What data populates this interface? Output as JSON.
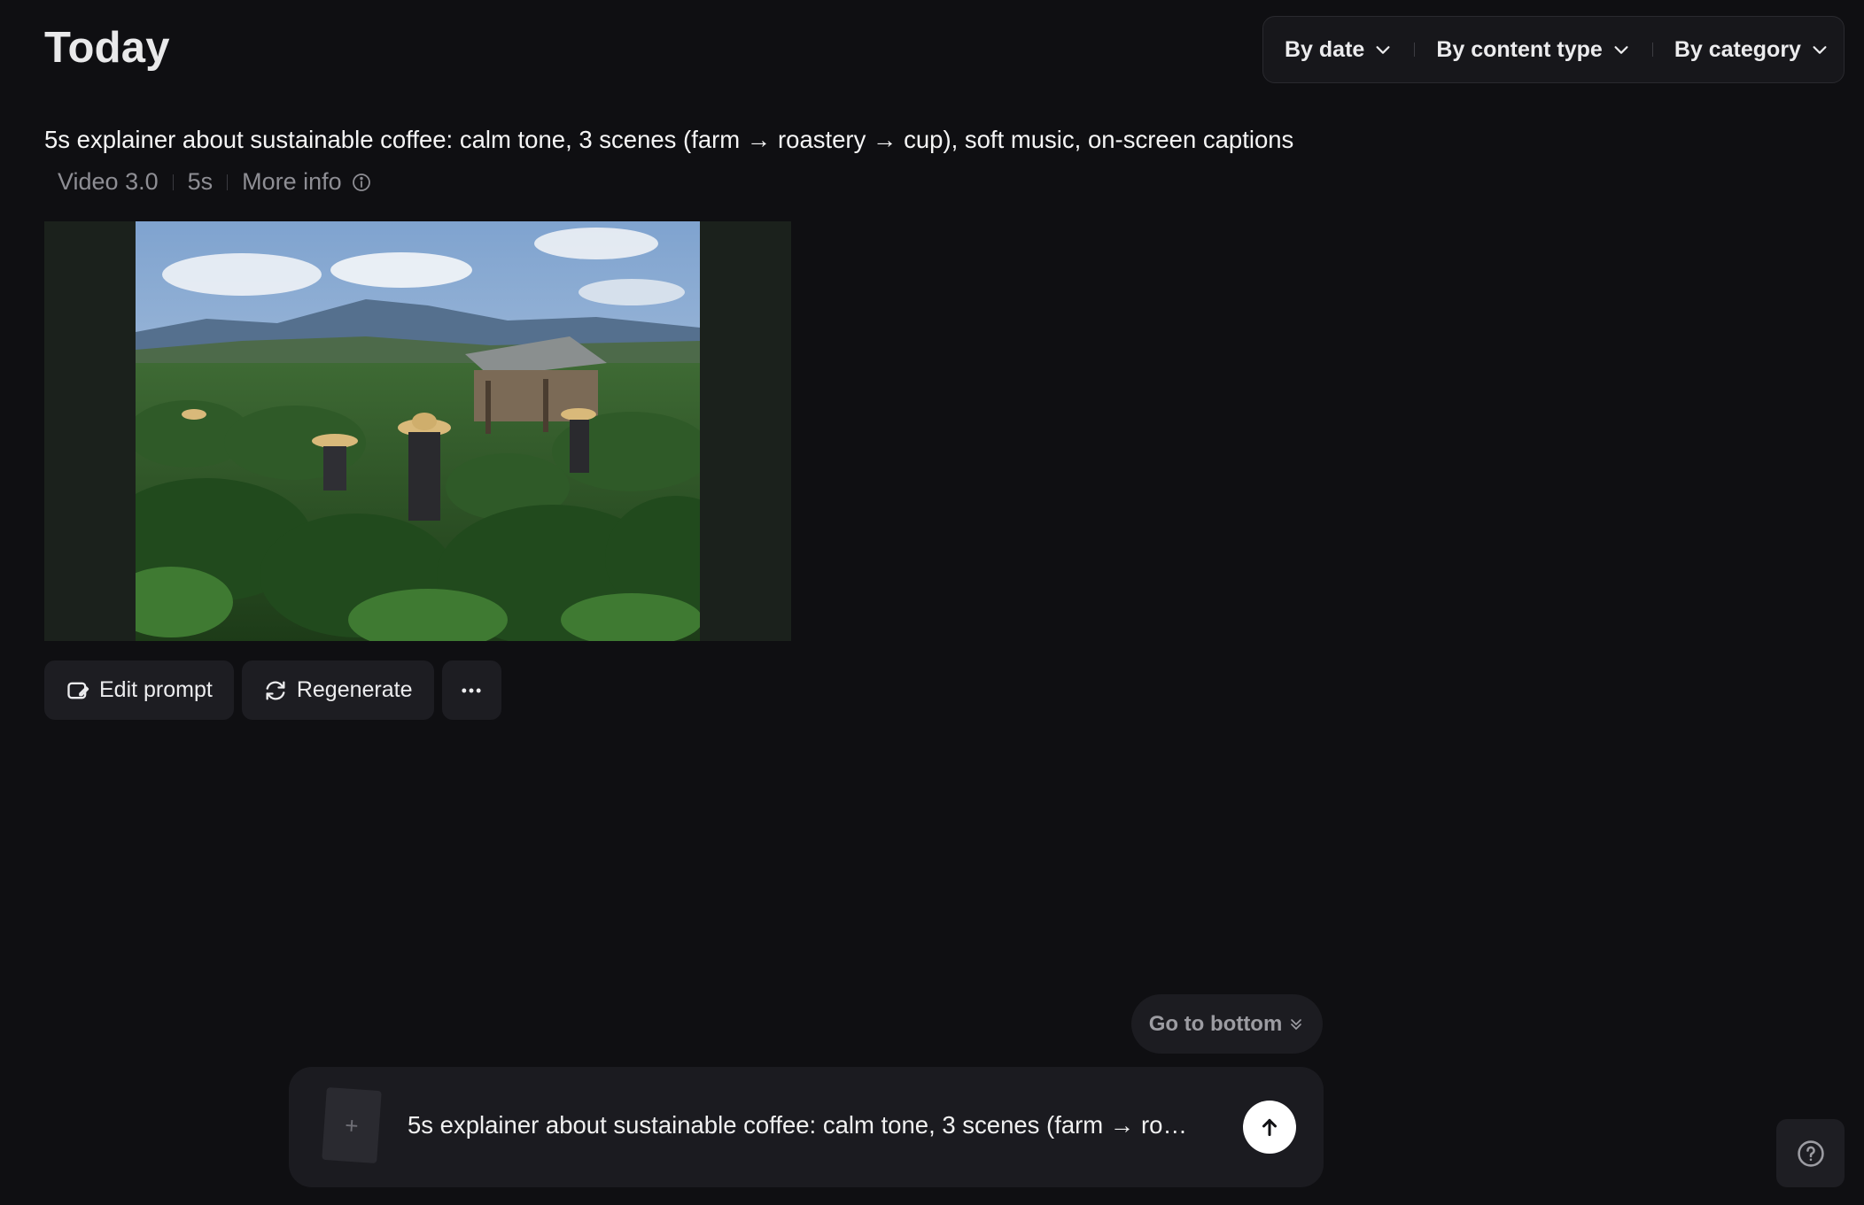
{
  "header": {
    "title": "Today"
  },
  "filters": [
    {
      "label": "By date",
      "icon": "chevron-down-icon"
    },
    {
      "label": "By content type",
      "icon": "chevron-down-icon"
    },
    {
      "label": "By category",
      "icon": "chevron-down-icon"
    }
  ],
  "generation": {
    "prompt": "5s explainer about sustainable coffee: calm tone, 3 scenes (farm → roastery → cup), soft music, on-screen captions",
    "model": "Video 3.0",
    "duration": "5s",
    "more_info": "More info",
    "preview": {
      "description_icon": "video-thumbnail"
    }
  },
  "actions": {
    "edit_prompt": "Edit prompt",
    "regenerate": "Regenerate",
    "more_icon": "ellipsis-icon"
  },
  "go_to_bottom": "Go to bottom",
  "composer": {
    "text": "5s explainer about sustainable coffee: calm tone, 3 scenes (farm → roaster...",
    "attach_label": "+",
    "send_icon": "arrow-up-icon"
  },
  "help_icon": "question-icon",
  "colors": {
    "background": "#0f0f12",
    "surface": "#1b1b20",
    "text": "#f2f2f2",
    "muted": "#8e8e94"
  }
}
